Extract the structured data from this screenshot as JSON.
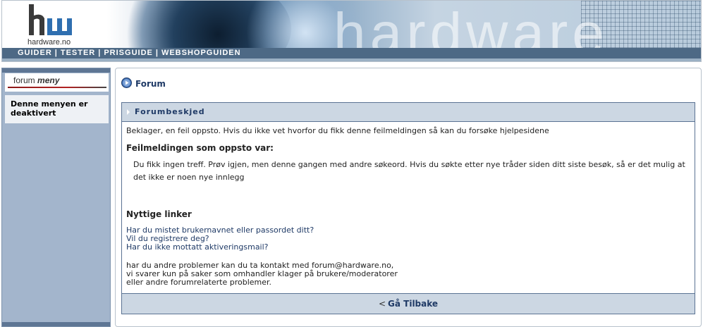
{
  "header": {
    "logo_text": "hardware.no",
    "banner_word": "hardware",
    "nav": [
      "GUIDER",
      "TESTER",
      "PRISGUIDE",
      "WEBSHOPGUIDEN"
    ],
    "nav_separator": "|"
  },
  "sidebar": {
    "title_plain": "forum",
    "title_emph": "meny",
    "message": "Denne menyen er deaktivert"
  },
  "main": {
    "title": "Forum",
    "title_icon": "play-circle-icon",
    "panel": {
      "heading": "Forumbeskjed",
      "intro": "Beklager, en feil oppsto. Hvis du ikke vet hvorfor du fikk denne feilmeldingen så kan du forsøke hjelpesidene",
      "error_label": "Feilmeldingen som oppsto var:",
      "error_text": "Du fikk ingen treff. Prøv igjen, men denne gangen med andre søkeord. Hvis du søkte etter nye tråder siden ditt siste besøk, så er det mulig at det ikke er noen nye innlegg",
      "links_heading": "Nyttige linker",
      "links": [
        "Har du mistet brukernavnet eller passordet ditt?",
        "Vil du registrere deg?",
        "Har du ikke mottatt aktiveringsmail?"
      ],
      "contact": [
        "har du andre problemer kan du ta kontakt med forum@hardware.no,",
        "vi svarer kun på saker som omhandler klager på brukere/moderatorer",
        "eller andre forumrelaterte problemer."
      ],
      "back_symbol": "<",
      "back_label": "Gå Tilbake"
    }
  },
  "colors": {
    "nav_bg": "#4d6985",
    "sidebar_bg": "#a3b5cc",
    "panel_head_bg": "#ccd7e3",
    "panel_border": "#5b7393",
    "link_color": "#1f3a66"
  }
}
